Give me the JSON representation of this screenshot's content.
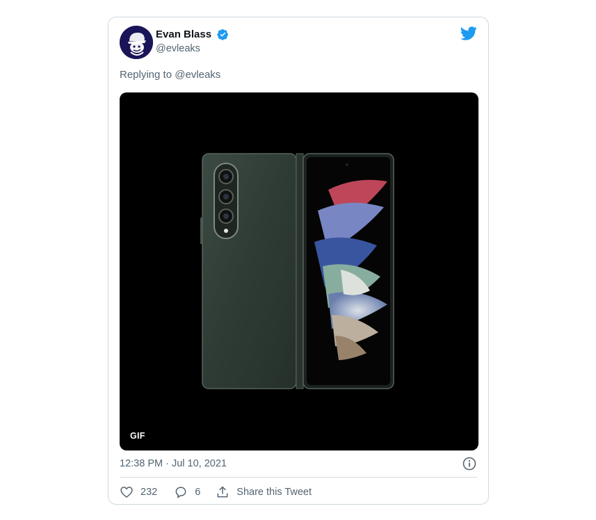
{
  "tweet": {
    "author": {
      "display_name": "Evan Blass",
      "handle": "@evleaks",
      "verified_icon": "verified-badge-icon",
      "avatar_icon": "avatar"
    },
    "brand_icon": "twitter-bird-icon",
    "replying_to": "Replying to @evleaks",
    "media": {
      "badge": "GIF"
    },
    "timestamp": "12:38 PM · Jul 10, 2021",
    "actions": {
      "like_count": "232",
      "reply_count": "6",
      "share_label": "Share this Tweet"
    },
    "colors": {
      "brand": "#1d9bf0",
      "secondary_text": "#536471",
      "border": "#cfd9de",
      "avatar_bg": "#1a1458"
    }
  }
}
